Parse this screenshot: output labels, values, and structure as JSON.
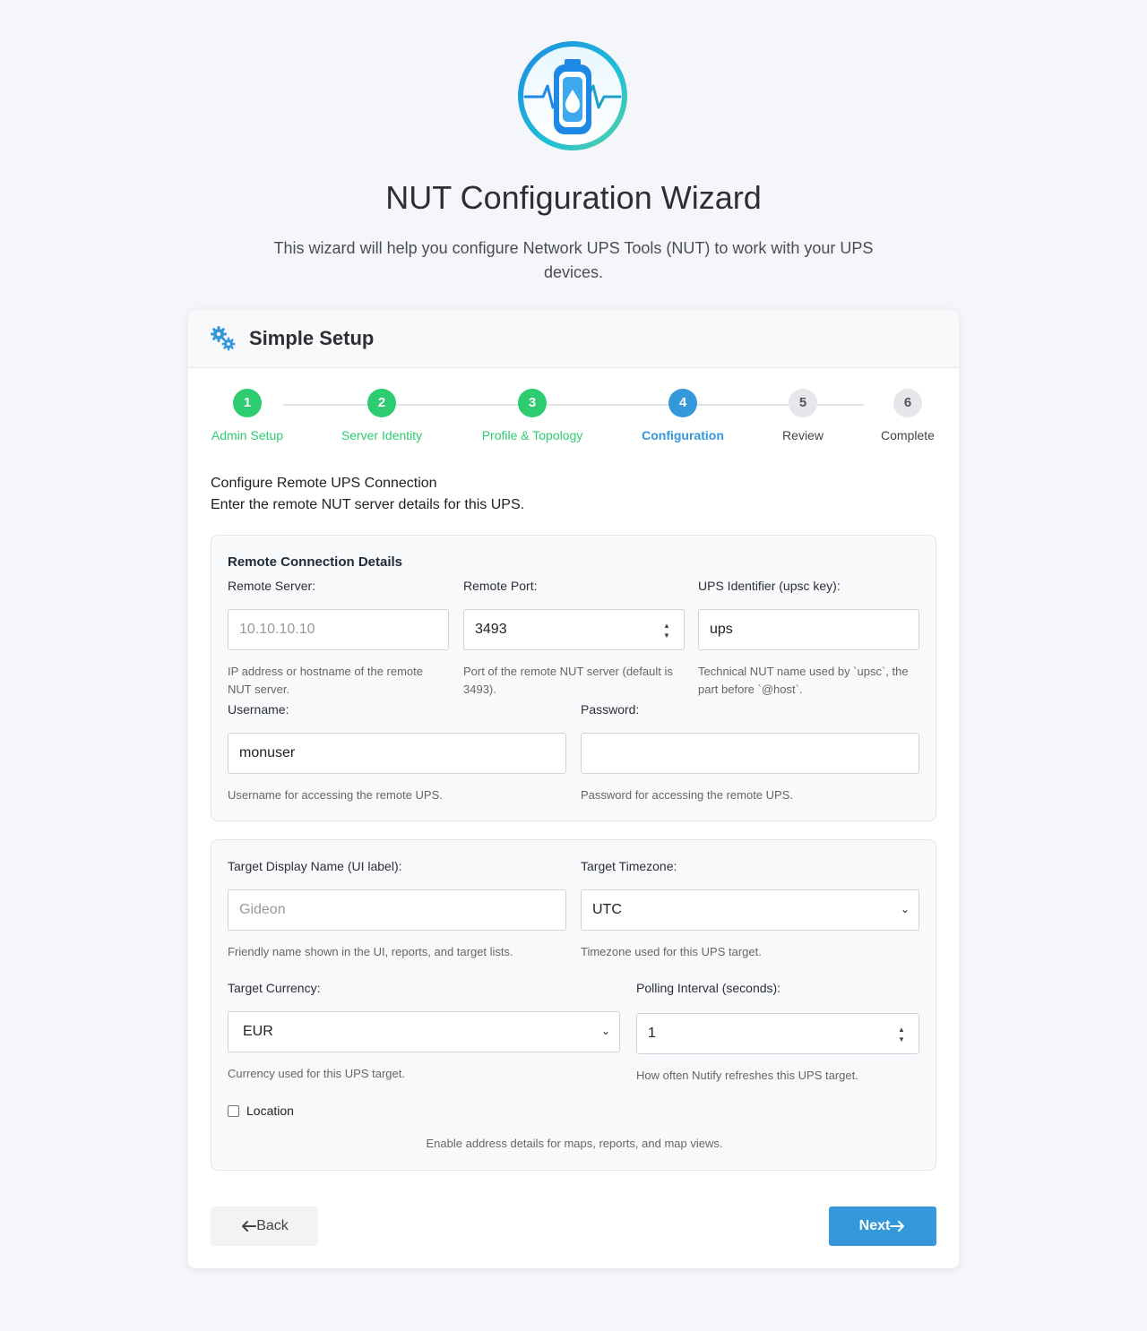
{
  "page": {
    "title": "NUT Configuration Wizard",
    "intro": "This wizard will help you configure Network UPS Tools (NUT) to work with your UPS devices."
  },
  "card": {
    "header": "Simple Setup"
  },
  "steps": [
    {
      "number": "1",
      "label": "Admin Setup",
      "state": "done"
    },
    {
      "number": "2",
      "label": "Server Identity",
      "state": "done"
    },
    {
      "number": "3",
      "label": "Profile & Topology",
      "state": "done"
    },
    {
      "number": "4",
      "label": "Configuration",
      "state": "active"
    },
    {
      "number": "5",
      "label": "Review",
      "state": "todo"
    },
    {
      "number": "6",
      "label": "Complete",
      "state": "todo"
    }
  ],
  "section": {
    "title": "Configure Remote UPS Connection",
    "subtitle": "Enter the remote NUT server details for this UPS."
  },
  "remote": {
    "title": "Remote Connection Details",
    "server": {
      "label": "Remote Server:",
      "placeholder": "10.10.10.10",
      "value": "",
      "help": "IP address or hostname of the remote NUT server."
    },
    "port": {
      "label": "Remote Port:",
      "value": "3493",
      "help": "Port of the remote NUT server (default is 3493)."
    },
    "identifier": {
      "label": "UPS Identifier (upsc key):",
      "value": "ups",
      "help": "Technical NUT name used by `upsc`, the part before `@host`."
    },
    "username": {
      "label": "Username:",
      "value": "monuser",
      "help": "Username for accessing the remote UPS."
    },
    "password": {
      "label": "Password:",
      "value": "",
      "help": "Password for accessing the remote UPS."
    }
  },
  "target": {
    "display_name": {
      "label": "Target Display Name (UI label):",
      "placeholder": "Gideon",
      "value": "",
      "help": "Friendly name shown in the UI, reports, and target lists."
    },
    "timezone": {
      "label": "Target Timezone:",
      "value": "UTC",
      "help": "Timezone used for this UPS target."
    },
    "currency": {
      "label": "Target Currency:",
      "value": "EUR",
      "help": "Currency used for this UPS target."
    },
    "polling": {
      "label": "Polling Interval (seconds):",
      "value": "1",
      "help": "How often Nutify refreshes this UPS target."
    },
    "location": {
      "label": "Location",
      "checked": false,
      "help": "Enable address details for maps, reports, and map views."
    }
  },
  "buttons": {
    "back": "Back",
    "next": "Next"
  },
  "colors": {
    "done": "#2ecc71",
    "active": "#3498db",
    "todo": "#e5e7eb",
    "primary": "#3498db"
  }
}
